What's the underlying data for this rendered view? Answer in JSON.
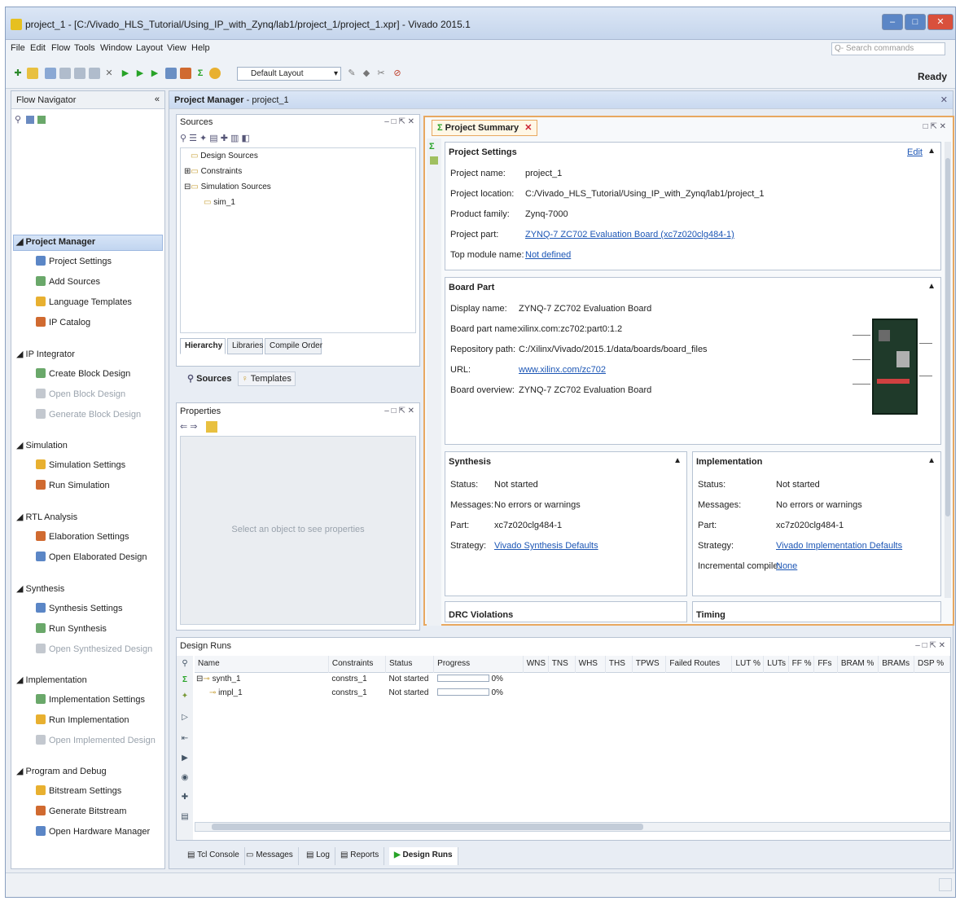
{
  "window": {
    "title": "project_1 - [C:/Vivado_HLS_Tutorial/Using_IP_with_Zynq/lab1/project_1/project_1.xpr] - Vivado 2015.1",
    "minimize": "–",
    "maximize": "□",
    "close": "✕"
  },
  "menu": [
    "File",
    "Edit",
    "Flow",
    "Tools",
    "Window",
    "Layout",
    "View",
    "Help"
  ],
  "search": {
    "placeholder": "Q- Search commands"
  },
  "toolbar": {
    "layout": "Default Layout",
    "status": "Ready"
  },
  "flow_nav": {
    "title": "Flow Navigator",
    "sections": [
      {
        "label": "Project Manager",
        "items": [
          {
            "label": "Project Settings",
            "disabled": false
          },
          {
            "label": "Add Sources",
            "disabled": false
          },
          {
            "label": "Language Templates",
            "disabled": false
          },
          {
            "label": "IP Catalog",
            "disabled": false
          }
        ]
      },
      {
        "label": "IP Integrator",
        "items": [
          {
            "label": "Create Block Design",
            "disabled": false
          },
          {
            "label": "Open Block Design",
            "disabled": true
          },
          {
            "label": "Generate Block Design",
            "disabled": true
          }
        ]
      },
      {
        "label": "Simulation",
        "items": [
          {
            "label": "Simulation Settings",
            "disabled": false
          },
          {
            "label": "Run Simulation",
            "disabled": false
          }
        ]
      },
      {
        "label": "RTL Analysis",
        "items": [
          {
            "label": "Elaboration Settings",
            "disabled": false
          },
          {
            "label": "Open Elaborated Design",
            "disabled": false
          }
        ]
      },
      {
        "label": "Synthesis",
        "items": [
          {
            "label": "Synthesis Settings",
            "disabled": false
          },
          {
            "label": "Run Synthesis",
            "disabled": false
          },
          {
            "label": "Open Synthesized Design",
            "disabled": true
          }
        ]
      },
      {
        "label": "Implementation",
        "items": [
          {
            "label": "Implementation Settings",
            "disabled": false
          },
          {
            "label": "Run Implementation",
            "disabled": false
          },
          {
            "label": "Open Implemented Design",
            "disabled": true
          }
        ]
      },
      {
        "label": "Program and Debug",
        "items": [
          {
            "label": "Bitstream Settings",
            "disabled": false
          },
          {
            "label": "Generate Bitstream",
            "disabled": false
          },
          {
            "label": "Open Hardware Manager",
            "disabled": false
          }
        ]
      }
    ]
  },
  "project_manager": {
    "title": "Project Manager",
    "project": "- project_1"
  },
  "sources": {
    "title": "Sources",
    "tree": [
      "Design Sources",
      "Constraints",
      "Simulation Sources",
      "sim_1"
    ],
    "tabs": [
      "Hierarchy",
      "Libraries",
      "Compile Order"
    ],
    "subtabs": [
      "Sources",
      "Templates"
    ]
  },
  "properties": {
    "title": "Properties",
    "empty": "Select an object to see properties"
  },
  "summary": {
    "tab": "Project Summary",
    "settings": {
      "title": "Project Settings",
      "edit": "Edit",
      "rows": [
        {
          "k": "Project name:",
          "v": "project_1",
          "link": false
        },
        {
          "k": "Project location:",
          "v": "C:/Vivado_HLS_Tutorial/Using_IP_with_Zynq/lab1/project_1",
          "link": false
        },
        {
          "k": "Product family:",
          "v": "Zynq-7000",
          "link": false
        },
        {
          "k": "Project part:",
          "v": "ZYNQ-7 ZC702 Evaluation Board (xc7z020clg484-1)",
          "link": true
        },
        {
          "k": "Top module name:",
          "v": "Not defined",
          "link": true
        }
      ]
    },
    "board": {
      "title": "Board Part",
      "rows": [
        {
          "k": "Display name:",
          "v": "ZYNQ-7 ZC702 Evaluation Board",
          "link": false
        },
        {
          "k": "Board part name:",
          "v": "xilinx.com:zc702:part0:1.2",
          "link": false
        },
        {
          "k": "Repository path:",
          "v": "C:/Xilinx/Vivado/2015.1/data/boards/board_files",
          "link": false
        },
        {
          "k": "URL:",
          "v": "www.xilinx.com/zc702",
          "link": true
        },
        {
          "k": "Board overview:",
          "v": "ZYNQ-7 ZC702 Evaluation Board",
          "link": false
        }
      ]
    },
    "synthesis": {
      "title": "Synthesis",
      "rows": [
        {
          "k": "Status:",
          "v": "Not started",
          "link": false
        },
        {
          "k": "Messages:",
          "v": "No errors or warnings",
          "link": false
        },
        {
          "k": "Part:",
          "v": "xc7z020clg484-1",
          "link": false
        },
        {
          "k": "Strategy:",
          "v": "Vivado Synthesis Defaults",
          "link": true
        }
      ]
    },
    "implementation": {
      "title": "Implementation",
      "rows": [
        {
          "k": "Status:",
          "v": "Not started",
          "link": false
        },
        {
          "k": "Messages:",
          "v": "No errors or warnings",
          "link": false
        },
        {
          "k": "Part:",
          "v": "xc7z020clg484-1",
          "link": false
        },
        {
          "k": "Strategy:",
          "v": "Vivado Implementation Defaults",
          "link": true
        },
        {
          "k": "Incremental compile:",
          "v": "None",
          "link": true
        }
      ]
    },
    "drc": "DRC Violations",
    "timing": "Timing"
  },
  "design_runs": {
    "title": "Design Runs",
    "columns": [
      "Name",
      "Constraints",
      "Status",
      "Progress",
      "WNS",
      "TNS",
      "WHS",
      "THS",
      "TPWS",
      "Failed Routes",
      "LUT %",
      "LUTs",
      "FF %",
      "FFs",
      "BRAM %",
      "BRAMs",
      "DSP %"
    ],
    "rows": [
      {
        "name": "synth_1",
        "constraints": "constrs_1",
        "status": "Not started",
        "progress": "0%"
      },
      {
        "name": "impl_1",
        "constraints": "constrs_1",
        "status": "Not started",
        "progress": "0%"
      }
    ]
  },
  "bottom_tabs": [
    "Tcl Console",
    "Messages",
    "Log",
    "Reports",
    "Design Runs"
  ]
}
